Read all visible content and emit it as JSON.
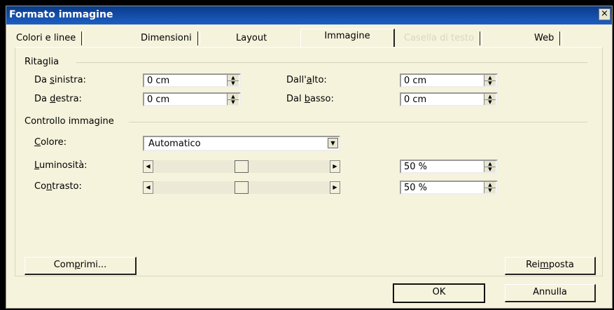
{
  "window": {
    "title": "Formato immagine",
    "close_label": "×"
  },
  "tabs": [
    {
      "label": "Colori e linee"
    },
    {
      "label": "Dimensioni"
    },
    {
      "label": "Layout"
    },
    {
      "label": "Immagine",
      "active": true
    },
    {
      "label": "Casella di testo",
      "disabled": true
    },
    {
      "label": "Web"
    }
  ],
  "crop": {
    "title": "Ritaglia",
    "left": {
      "pre": "Da ",
      "key": "s",
      "post": "inistra:",
      "value": "0 cm"
    },
    "right": {
      "pre": "Da ",
      "key": "d",
      "post": "estra:",
      "value": "0 cm"
    },
    "top": {
      "pre": "Dall'",
      "key": "a",
      "post": "lto:",
      "value": "0 cm"
    },
    "bottom": {
      "pre": "Dal ",
      "key": "b",
      "post": "asso:",
      "value": "0 cm"
    }
  },
  "image_control": {
    "title": "Controllo immagine",
    "color": {
      "pre": "",
      "key": "C",
      "post": "olore:",
      "value": "Automatico"
    },
    "brightness": {
      "pre": "",
      "key": "L",
      "post": "uminosità:",
      "value": "50 %",
      "level": 0.5
    },
    "contrast": {
      "pre": "Co",
      "key": "n",
      "post": "trasto:",
      "value": "50 %",
      "level": 0.5
    }
  },
  "buttons": {
    "compress": {
      "pre": "Com",
      "key": "p",
      "post": "rimi..."
    },
    "reset": {
      "pre": "Rei",
      "key": "m",
      "post": "posta"
    },
    "ok": "OK",
    "cancel": "Annulla"
  },
  "colors": {
    "titlebar": "#1d5fc4",
    "dialog_bg": "#f5f3dc",
    "disabled_text": "#d9d7c0"
  }
}
